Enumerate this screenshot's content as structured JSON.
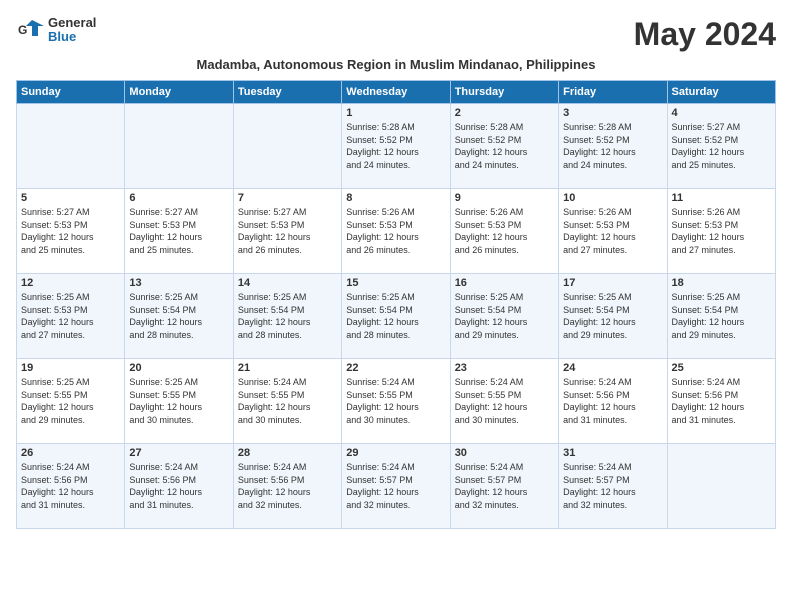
{
  "logo": {
    "general": "General",
    "blue": "Blue"
  },
  "title": "May 2024",
  "subtitle": "Madamba, Autonomous Region in Muslim Mindanao, Philippines",
  "days_of_week": [
    "Sunday",
    "Monday",
    "Tuesday",
    "Wednesday",
    "Thursday",
    "Friday",
    "Saturday"
  ],
  "weeks": [
    [
      {
        "day": "",
        "info": ""
      },
      {
        "day": "",
        "info": ""
      },
      {
        "day": "",
        "info": ""
      },
      {
        "day": "1",
        "info": "Sunrise: 5:28 AM\nSunset: 5:52 PM\nDaylight: 12 hours\nand 24 minutes."
      },
      {
        "day": "2",
        "info": "Sunrise: 5:28 AM\nSunset: 5:52 PM\nDaylight: 12 hours\nand 24 minutes."
      },
      {
        "day": "3",
        "info": "Sunrise: 5:28 AM\nSunset: 5:52 PM\nDaylight: 12 hours\nand 24 minutes."
      },
      {
        "day": "4",
        "info": "Sunrise: 5:27 AM\nSunset: 5:52 PM\nDaylight: 12 hours\nand 25 minutes."
      }
    ],
    [
      {
        "day": "5",
        "info": "Sunrise: 5:27 AM\nSunset: 5:53 PM\nDaylight: 12 hours\nand 25 minutes."
      },
      {
        "day": "6",
        "info": "Sunrise: 5:27 AM\nSunset: 5:53 PM\nDaylight: 12 hours\nand 25 minutes."
      },
      {
        "day": "7",
        "info": "Sunrise: 5:27 AM\nSunset: 5:53 PM\nDaylight: 12 hours\nand 26 minutes."
      },
      {
        "day": "8",
        "info": "Sunrise: 5:26 AM\nSunset: 5:53 PM\nDaylight: 12 hours\nand 26 minutes."
      },
      {
        "day": "9",
        "info": "Sunrise: 5:26 AM\nSunset: 5:53 PM\nDaylight: 12 hours\nand 26 minutes."
      },
      {
        "day": "10",
        "info": "Sunrise: 5:26 AM\nSunset: 5:53 PM\nDaylight: 12 hours\nand 27 minutes."
      },
      {
        "day": "11",
        "info": "Sunrise: 5:26 AM\nSunset: 5:53 PM\nDaylight: 12 hours\nand 27 minutes."
      }
    ],
    [
      {
        "day": "12",
        "info": "Sunrise: 5:25 AM\nSunset: 5:53 PM\nDaylight: 12 hours\nand 27 minutes."
      },
      {
        "day": "13",
        "info": "Sunrise: 5:25 AM\nSunset: 5:54 PM\nDaylight: 12 hours\nand 28 minutes."
      },
      {
        "day": "14",
        "info": "Sunrise: 5:25 AM\nSunset: 5:54 PM\nDaylight: 12 hours\nand 28 minutes."
      },
      {
        "day": "15",
        "info": "Sunrise: 5:25 AM\nSunset: 5:54 PM\nDaylight: 12 hours\nand 28 minutes."
      },
      {
        "day": "16",
        "info": "Sunrise: 5:25 AM\nSunset: 5:54 PM\nDaylight: 12 hours\nand 29 minutes."
      },
      {
        "day": "17",
        "info": "Sunrise: 5:25 AM\nSunset: 5:54 PM\nDaylight: 12 hours\nand 29 minutes."
      },
      {
        "day": "18",
        "info": "Sunrise: 5:25 AM\nSunset: 5:54 PM\nDaylight: 12 hours\nand 29 minutes."
      }
    ],
    [
      {
        "day": "19",
        "info": "Sunrise: 5:25 AM\nSunset: 5:55 PM\nDaylight: 12 hours\nand 29 minutes."
      },
      {
        "day": "20",
        "info": "Sunrise: 5:25 AM\nSunset: 5:55 PM\nDaylight: 12 hours\nand 30 minutes."
      },
      {
        "day": "21",
        "info": "Sunrise: 5:24 AM\nSunset: 5:55 PM\nDaylight: 12 hours\nand 30 minutes."
      },
      {
        "day": "22",
        "info": "Sunrise: 5:24 AM\nSunset: 5:55 PM\nDaylight: 12 hours\nand 30 minutes."
      },
      {
        "day": "23",
        "info": "Sunrise: 5:24 AM\nSunset: 5:55 PM\nDaylight: 12 hours\nand 30 minutes."
      },
      {
        "day": "24",
        "info": "Sunrise: 5:24 AM\nSunset: 5:56 PM\nDaylight: 12 hours\nand 31 minutes."
      },
      {
        "day": "25",
        "info": "Sunrise: 5:24 AM\nSunset: 5:56 PM\nDaylight: 12 hours\nand 31 minutes."
      }
    ],
    [
      {
        "day": "26",
        "info": "Sunrise: 5:24 AM\nSunset: 5:56 PM\nDaylight: 12 hours\nand 31 minutes."
      },
      {
        "day": "27",
        "info": "Sunrise: 5:24 AM\nSunset: 5:56 PM\nDaylight: 12 hours\nand 31 minutes."
      },
      {
        "day": "28",
        "info": "Sunrise: 5:24 AM\nSunset: 5:56 PM\nDaylight: 12 hours\nand 32 minutes."
      },
      {
        "day": "29",
        "info": "Sunrise: 5:24 AM\nSunset: 5:57 PM\nDaylight: 12 hours\nand 32 minutes."
      },
      {
        "day": "30",
        "info": "Sunrise: 5:24 AM\nSunset: 5:57 PM\nDaylight: 12 hours\nand 32 minutes."
      },
      {
        "day": "31",
        "info": "Sunrise: 5:24 AM\nSunset: 5:57 PM\nDaylight: 12 hours\nand 32 minutes."
      },
      {
        "day": "",
        "info": ""
      }
    ]
  ]
}
